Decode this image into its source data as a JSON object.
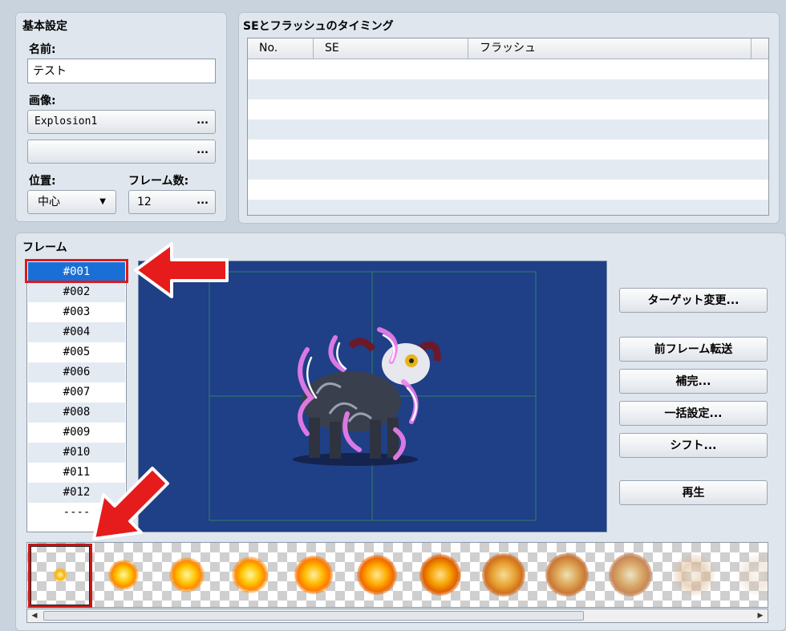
{
  "basic": {
    "title": "基本設定",
    "name_label": "名前:",
    "name_value": "テスト",
    "image_label": "画像:",
    "image1": "Explosion1",
    "image2": "",
    "ellipsis": "...",
    "position_label": "位置:",
    "position_value": "中心",
    "frames_label": "フレーム数:",
    "frames_value": "12"
  },
  "timing": {
    "title": "SEとフラッシュのタイミング",
    "columns": [
      "No.",
      "SE",
      "フラッシュ"
    ]
  },
  "frames": {
    "title": "フレーム",
    "items": [
      "#001",
      "#002",
      "#003",
      "#004",
      "#005",
      "#006",
      "#007",
      "#008",
      "#009",
      "#010",
      "#011",
      "#012",
      "----"
    ],
    "selected_index": 0
  },
  "actions": {
    "change_target": "ターゲット変更...",
    "copy_prev": "前フレーム転送",
    "tween": "補完...",
    "batch": "一括設定...",
    "shift": "シフト...",
    "play": "再生"
  },
  "cell_strip": {
    "cell_count": 12,
    "selected_index": 0
  },
  "colors": {
    "selection": "#1a6fd6",
    "highlight": "#e11818",
    "canvas": "#1f3f86"
  }
}
